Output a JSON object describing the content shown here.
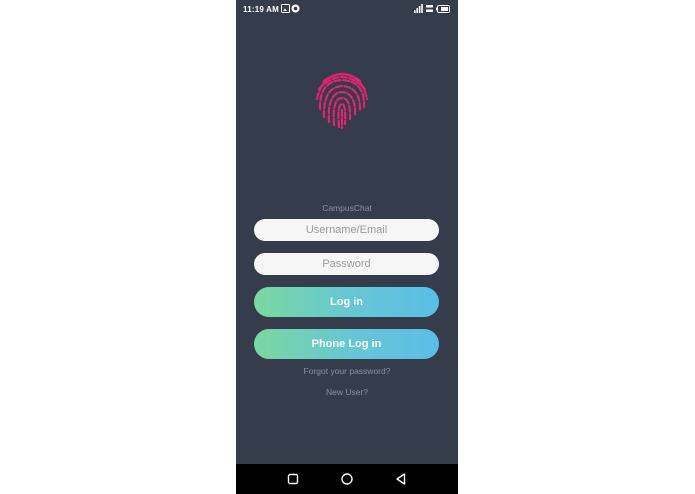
{
  "status_bar": {
    "time": "11:19 AM",
    "right_icons": [
      "sim-signal-icon",
      "network-speed-icon",
      "battery-icon"
    ],
    "left_icons": [
      "gallery-notification-icon",
      "app-notification-icon"
    ]
  },
  "app": {
    "name": "CampusChat",
    "logo": "fingerprint-icon",
    "accent_colors": {
      "logo": "#e0246f",
      "button_start": "#7bd8a0",
      "button_end": "#5bbde8",
      "background": "#353d4d"
    }
  },
  "form": {
    "username_placeholder": "Username/Email",
    "password_placeholder": "Password",
    "login_label": "Log in",
    "phone_login_label": "Phone Log in",
    "forgot_label": "Forgot your password?",
    "new_user_label": "New User?"
  },
  "navbar": {
    "icons": [
      "recents-square-icon",
      "home-circle-icon",
      "back-triangle-icon"
    ]
  }
}
